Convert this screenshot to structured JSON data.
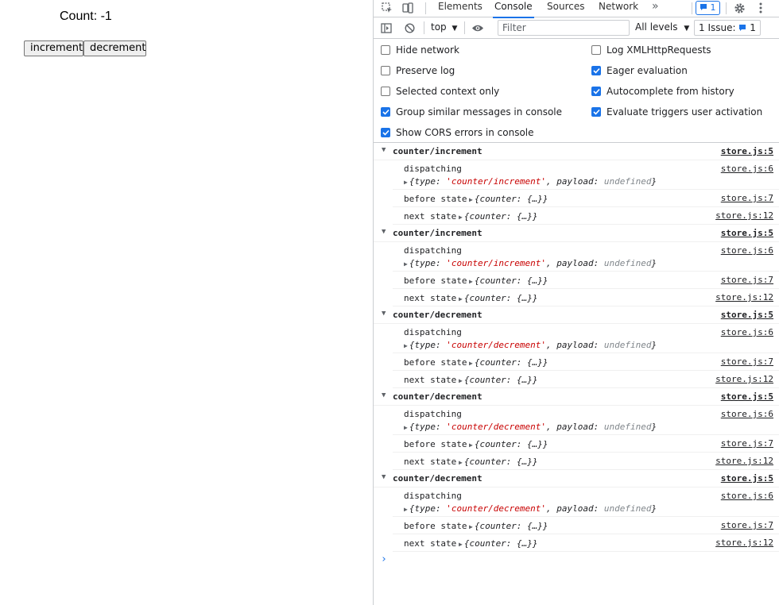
{
  "app": {
    "count_text": "Count: -1",
    "increment_label": "increment",
    "decrement_label": "decrement"
  },
  "devtools": {
    "tabs": [
      "Elements",
      "Console",
      "Sources",
      "Network"
    ],
    "active_tab": "Console",
    "more_tabs": "»",
    "message_badge": "1",
    "toolbar": {
      "context": "top",
      "filter_placeholder": "Filter",
      "levels": "All levels",
      "issues_label": "1 Issue:",
      "issues_count": "1"
    },
    "settings_left": [
      {
        "label": "Hide network",
        "checked": false
      },
      {
        "label": "Preserve log",
        "checked": false
      },
      {
        "label": "Selected context only",
        "checked": false
      },
      {
        "label": "Group similar messages in console",
        "checked": true
      },
      {
        "label": "Show CORS errors in console",
        "checked": true
      }
    ],
    "settings_right": [
      {
        "label": "Log XMLHttpRequests",
        "checked": false
      },
      {
        "label": "Eager evaluation",
        "checked": true
      },
      {
        "label": "Autocomplete from history",
        "checked": true
      },
      {
        "label": "Evaluate triggers user activation",
        "checked": true
      }
    ],
    "log_groups": [
      {
        "title": "counter/increment",
        "src": "store.js:5",
        "action_type": "'counter/increment'",
        "dispatch_src": "store.js:6",
        "before_src": "store.js:7",
        "next_src": "store.js:12"
      },
      {
        "title": "counter/increment",
        "src": "store.js:5",
        "action_type": "'counter/increment'",
        "dispatch_src": "store.js:6",
        "before_src": "store.js:7",
        "next_src": "store.js:12"
      },
      {
        "title": "counter/decrement",
        "src": "store.js:5",
        "action_type": "'counter/decrement'",
        "dispatch_src": "store.js:6",
        "before_src": "store.js:7",
        "next_src": "store.js:12"
      },
      {
        "title": "counter/decrement",
        "src": "store.js:5",
        "action_type": "'counter/decrement'",
        "dispatch_src": "store.js:6",
        "before_src": "store.js:7",
        "next_src": "store.js:12"
      },
      {
        "title": "counter/decrement",
        "src": "store.js:5",
        "action_type": "'counter/decrement'",
        "dispatch_src": "store.js:6",
        "before_src": "store.js:7",
        "next_src": "store.js:12"
      }
    ],
    "entry_labels": {
      "dispatching": "dispatching",
      "before_state": "before state",
      "next_state": "next state",
      "type_key": "type:",
      "payload_key": "payload:",
      "payload_val": "undefined",
      "state_obj": "{counter: {…}}"
    }
  }
}
